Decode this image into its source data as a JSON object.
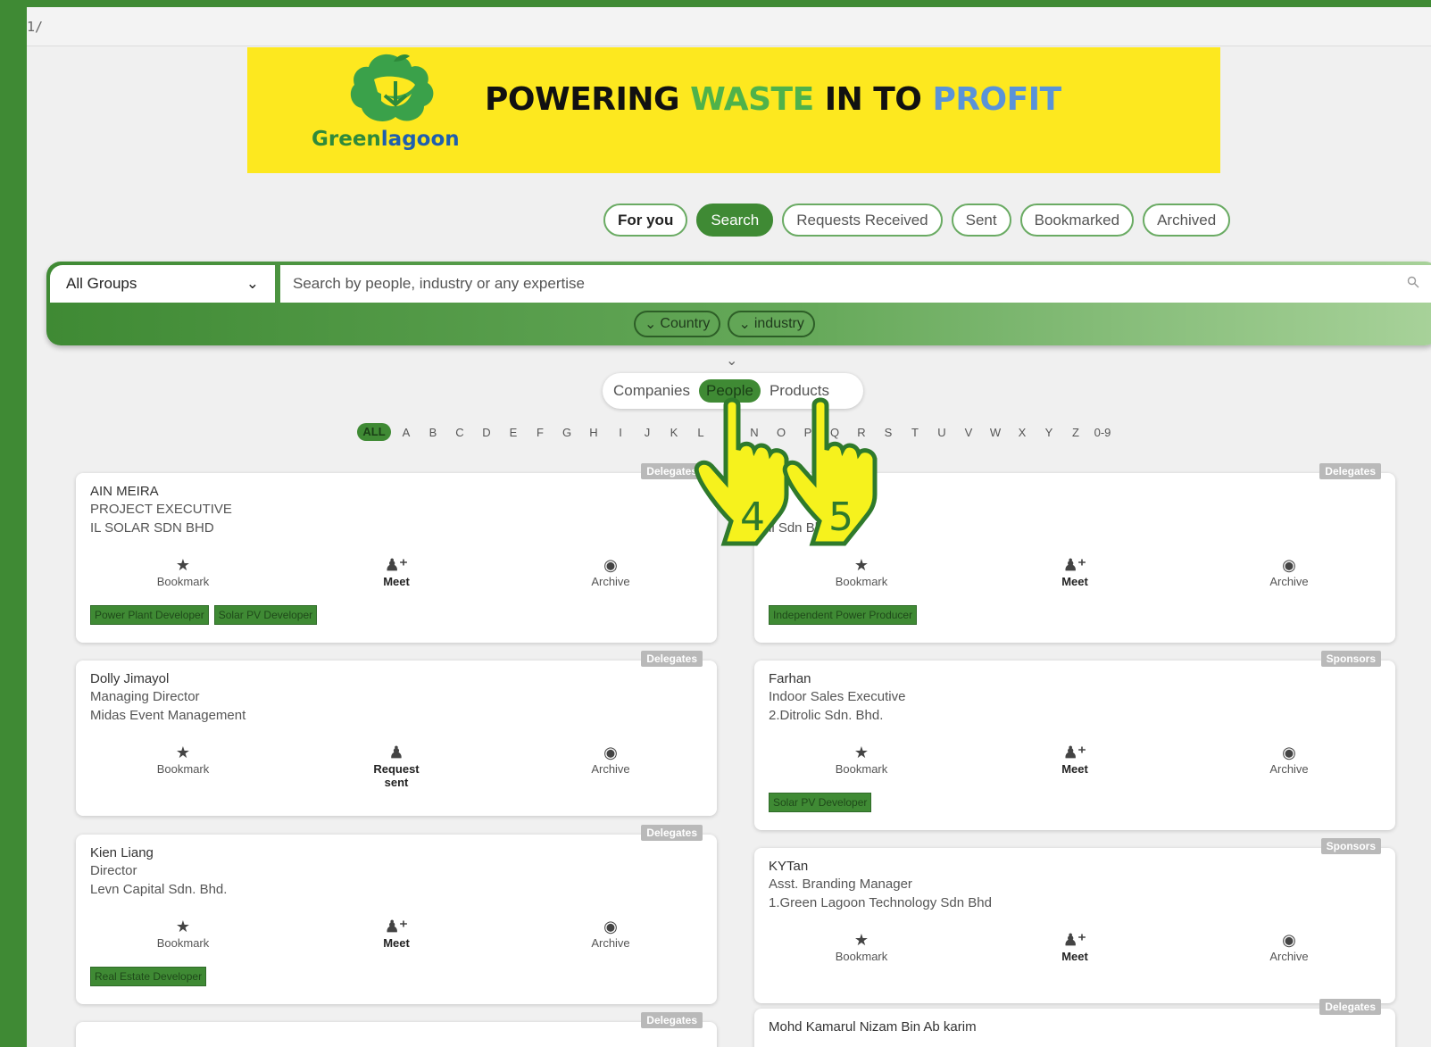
{
  "url": "1/",
  "banner": {
    "logo_green": "Green",
    "logo_blue": "lagoon",
    "tagline_1": "POWERING ",
    "tagline_2": "WASTE",
    "tagline_3": " IN TO ",
    "tagline_4": "PROFIT"
  },
  "tabs": [
    "For you",
    "Search",
    "Requests Received",
    "Sent",
    "Bookmarked",
    "Archived"
  ],
  "search": {
    "group_value": "All Groups",
    "placeholder": "Search by people, industry or any expertise",
    "filter_country": "Country",
    "filter_industry": "industry"
  },
  "segments": [
    "Companies",
    "People",
    "Products"
  ],
  "alphabet": [
    "ALL",
    "A",
    "B",
    "C",
    "D",
    "E",
    "F",
    "G",
    "H",
    "I",
    "J",
    "K",
    "L",
    "M",
    "N",
    "O",
    "P",
    "Q",
    "R",
    "S",
    "T",
    "U",
    "V",
    "W",
    "X",
    "Y",
    "Z",
    "0-9"
  ],
  "actions": {
    "bookmark": "Bookmark",
    "meet": "Meet",
    "archive": "Archive",
    "request_sent_1": "Request",
    "request_sent_2": "sent"
  },
  "cards": [
    {
      "badge": "Delegates",
      "name": "AIN MEIRA",
      "title": "PROJECT EXECUTIVE",
      "company": "IL SOLAR SDN BHD",
      "tags": [
        "Power Plant Developer",
        "Solar PV Developer"
      ]
    },
    {
      "badge": "Delegates",
      "name": "",
      "title": "",
      "company": "ll Sdn Bhd",
      "tags": [
        "Independent Power Producer"
      ]
    },
    {
      "badge": "Delegates",
      "name": "Dolly Jimayol",
      "title": "Managing Director",
      "company": "Midas Event Management",
      "tags": []
    },
    {
      "badge": "Sponsors",
      "name": "Farhan",
      "title": "Indoor Sales Executive",
      "company": "2.Ditrolic Sdn. Bhd.",
      "tags": [
        "Solar PV Developer"
      ]
    },
    {
      "badge": "Delegates",
      "name": "Kien Liang",
      "title": "Director",
      "company": "Levn Capital Sdn. Bhd.",
      "tags": [
        "Real Estate Developer"
      ]
    },
    {
      "badge": "Sponsors",
      "name": "KYTan",
      "title": "Asst. Branding Manager",
      "company": "1.Green Lagoon Technology Sdn Bhd",
      "tags": []
    },
    {
      "badge": "Delegates",
      "name": "",
      "title": "",
      "company": "",
      "tags": []
    },
    {
      "badge": "Delegates",
      "name": "Mohd Kamarul Nizam Bin Ab karim",
      "title": "",
      "company": "",
      "tags": []
    }
  ],
  "cursors": [
    "4",
    "5"
  ]
}
